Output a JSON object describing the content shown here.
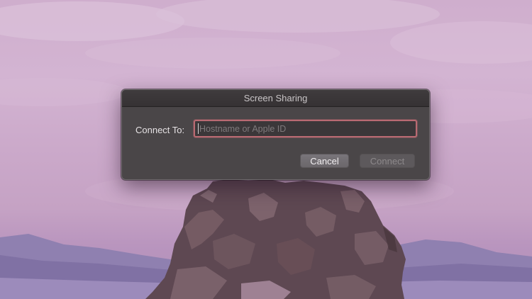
{
  "dialog": {
    "title": "Screen Sharing",
    "connect_label": "Connect To:",
    "input": {
      "value": "",
      "placeholder": "Hostname or Apple ID"
    },
    "cancel_label": "Cancel",
    "connect_label_button": "Connect",
    "connect_enabled": false
  },
  "colors": {
    "dialog_bg": "#4a4648",
    "focus_ring": "#b96a72",
    "sky": "#d3b4d2",
    "mountains": "#8e7eb0"
  }
}
